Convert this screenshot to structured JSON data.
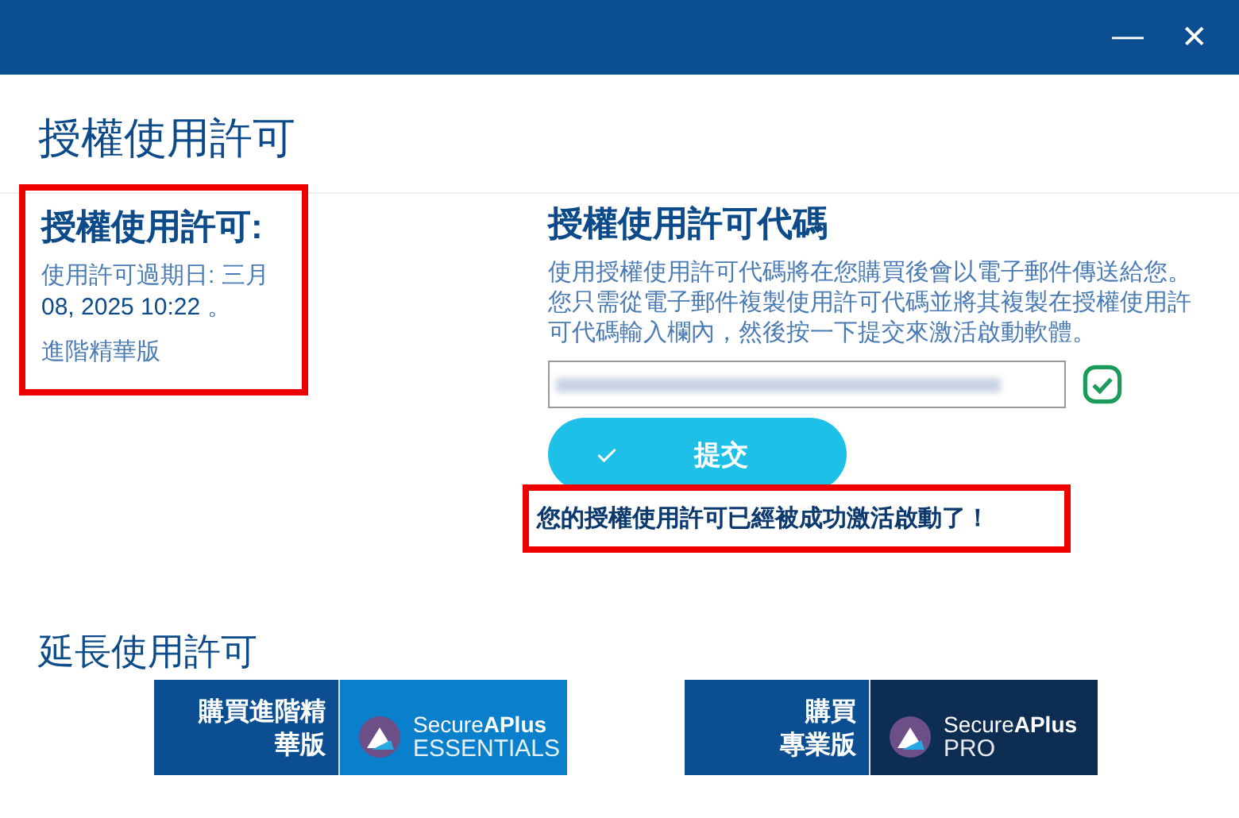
{
  "window": {
    "title": "授權使用許可",
    "controls": [
      "—",
      "✕"
    ]
  },
  "license": {
    "heading": "授權使用許可:",
    "expiry_label": "使用許可過期日: 三月",
    "expiry_value": "08, 2025 10:22",
    "expiry_end": " 。",
    "edition": "進階精華版",
    "highlighted": true
  },
  "code": {
    "heading": "授權使用許可代碼",
    "paragraphs": [
      "使用授權使用許可代碼將在您購買後會以電子郵件傳送給您。",
      "您只需從電子郵件複製使用許可代碼並將其複製在授權使用許可代碼輸入欄內，然後按一下提交來激活啟動軟體。"
    ],
    "valid": true,
    "submit": "提交",
    "message": "您的授權使用許可已經被成功激活啟動了！",
    "message_highlighted": true
  },
  "extend": {
    "heading": "延長使用許可",
    "products": [
      {
        "label": [
          "購買進階精",
          "華版"
        ],
        "brand": "SecureAPlus",
        "edition": "ESSENTIALS",
        "kind": "essentials"
      },
      {
        "label": [
          "購買",
          "專業版"
        ],
        "brand": "SecureAPlus",
        "edition": "PRO",
        "kind": "pro"
      }
    ]
  }
}
